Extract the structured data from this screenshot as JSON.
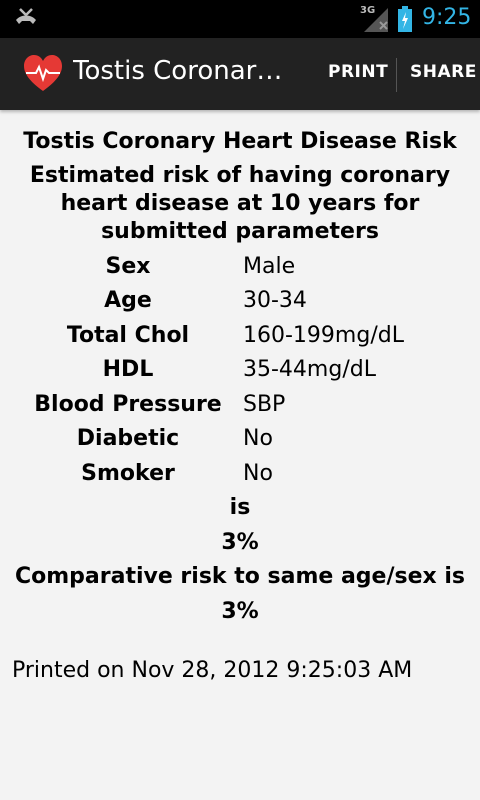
{
  "status_bar": {
    "network": "3G",
    "time": "9:25",
    "icons": [
      "missed-call-icon",
      "signal-icon",
      "battery-charging-icon"
    ]
  },
  "action_bar": {
    "title": "Tostis Coronary…",
    "print_label": "PRINT",
    "share_label": "SHARE",
    "icon": "heart-icon"
  },
  "report": {
    "title": "Tostis Coronary Heart Disease Risk",
    "subtitle": "Estimated risk of having coronary heart disease at 10 years for submitted parameters",
    "params": [
      {
        "label": "Sex",
        "value": "Male"
      },
      {
        "label": "Age",
        "value": "30-34"
      },
      {
        "label": "Total Chol",
        "value": "160-199mg/dL"
      },
      {
        "label": "HDL",
        "value": "35-44mg/dL"
      },
      {
        "label": "Blood Pressure",
        "value": "SBP"
      },
      {
        "label": "Diabetic",
        "value": "No"
      },
      {
        "label": "Smoker",
        "value": "No"
      }
    ],
    "is_text": "is",
    "risk_value": "3%",
    "comparative_text": "Comparative risk to same age/sex is",
    "comparative_value": "3%",
    "printed_on": "Printed on Nov 28, 2012 9:25:03 AM"
  },
  "colors": {
    "status_accent": "#33b5e5",
    "action_bar_bg": "#222222",
    "content_bg": "#f3f3f3",
    "heart_red": "#e53935"
  }
}
